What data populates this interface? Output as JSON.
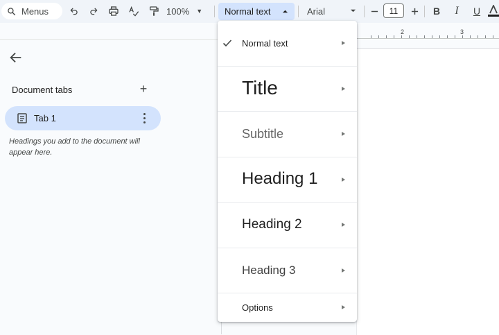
{
  "toolbar": {
    "menus_label": "Menus",
    "zoom": "100%",
    "style_value": "Normal text",
    "font_value": "Arial",
    "font_size": "11",
    "bold": "B",
    "italic": "I",
    "underline": "U"
  },
  "ruler": {
    "labels": [
      "2",
      "3"
    ]
  },
  "sidebar": {
    "title": "Document tabs",
    "add": "+",
    "tab_label": "Tab 1",
    "hint": "Headings you add to the document will appear here."
  },
  "style_menu": {
    "items": [
      {
        "label": "Normal text",
        "checked": true
      },
      {
        "label": "Title"
      },
      {
        "label": "Subtitle"
      },
      {
        "label": "Heading 1"
      },
      {
        "label": "Heading 2"
      },
      {
        "label": "Heading 3"
      },
      {
        "label": "Options"
      }
    ]
  },
  "colors": {
    "accent_bg": "#d3e3fd",
    "toolbar_bg": "#f0f4f9",
    "subtitle_gray": "#666666"
  }
}
